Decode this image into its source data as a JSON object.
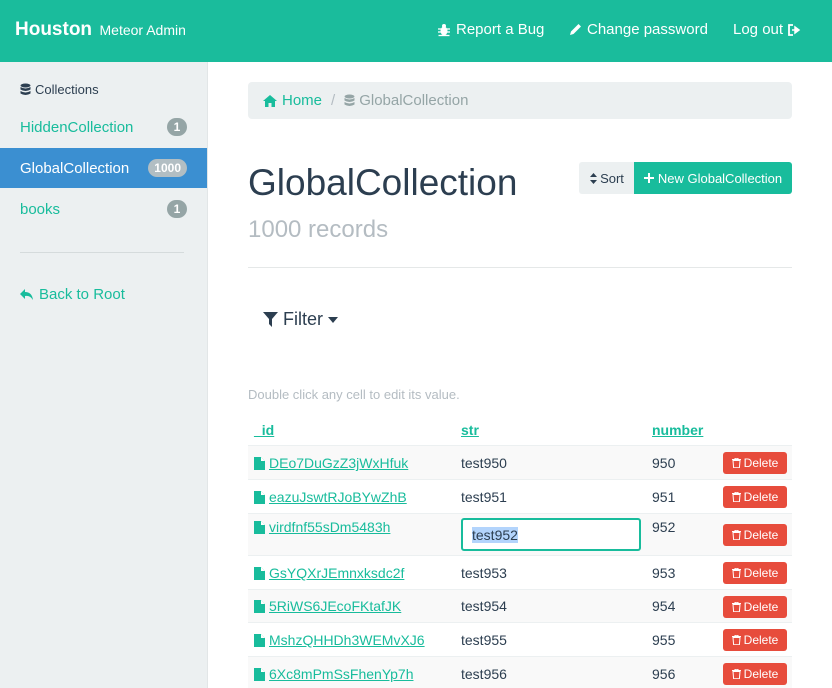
{
  "navbar": {
    "brand": "Houston",
    "brand_sub": "Meteor Admin",
    "report_bug": "Report a Bug",
    "change_password": "Change password",
    "logout": "Log out",
    "background": "#1abc9c"
  },
  "sidebar": {
    "header": "Collections",
    "items": [
      {
        "label": "HiddenCollection",
        "count": "1"
      },
      {
        "label": "GlobalCollection",
        "count": "1000"
      },
      {
        "label": "books",
        "count": "1"
      }
    ],
    "active_color": "#3b8fd1",
    "back": "Back to Root"
  },
  "breadcrumb": {
    "home": "Home",
    "separator": "/",
    "current": "GlobalCollection"
  },
  "main": {
    "title": "GlobalCollection",
    "records": "1000 records",
    "sort_label": "Sort",
    "new_label": "New GlobalCollection",
    "filter_label": "Filter",
    "hint": "Double click any cell to edit its value."
  },
  "table": {
    "columns": [
      "_id",
      "str",
      "number"
    ],
    "delete_label": "Delete",
    "rows": [
      {
        "id": "DEo7DuGzZ3jWxHfuk",
        "str": "test950",
        "number": "950"
      },
      {
        "id": "eazuJswtRJoBYwZhB",
        "str": "test951",
        "number": "951"
      },
      {
        "id": "virdfnf55sDm5483h",
        "str": "test952",
        "number": "952",
        "editing": true
      },
      {
        "id": "GsYQXrJEmnxksdc2f",
        "str": "test953",
        "number": "953"
      },
      {
        "id": "5RiWS6JEcoFKtafJK",
        "str": "test954",
        "number": "954"
      },
      {
        "id": "MshzQHHDh3WEMvXJ6",
        "str": "test955",
        "number": "955"
      },
      {
        "id": "6Xc8mPmSsFhenYp7h",
        "str": "test956",
        "number": "956"
      }
    ]
  }
}
